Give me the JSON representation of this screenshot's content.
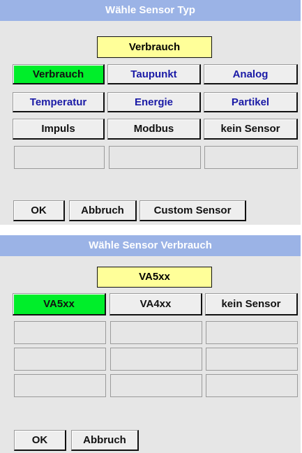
{
  "panel1": {
    "title": "Wähle Sensor Typ",
    "selected_value": "Verbrauch",
    "options": [
      "Verbrauch",
      "Taupunkt",
      "Analog",
      "Temperatur",
      "Energie",
      "Partikel",
      "Impuls",
      "Modbus",
      "kein Sensor"
    ],
    "ok_label": "OK",
    "cancel_label": "Abbruch",
    "custom_label": "Custom Sensor"
  },
  "panel2": {
    "title": "Wähle Sensor Verbrauch",
    "selected_value": "VA5xx",
    "options": [
      "VA5xx",
      "VA4xx",
      "kein Sensor"
    ],
    "ok_label": "OK",
    "cancel_label": "Abbruch"
  },
  "colors": {
    "title_bar": "#9bb3e6",
    "selected_field": "#ffff99",
    "active_option": "#00ee2a",
    "option_text_blue": "#1a1aa6"
  }
}
